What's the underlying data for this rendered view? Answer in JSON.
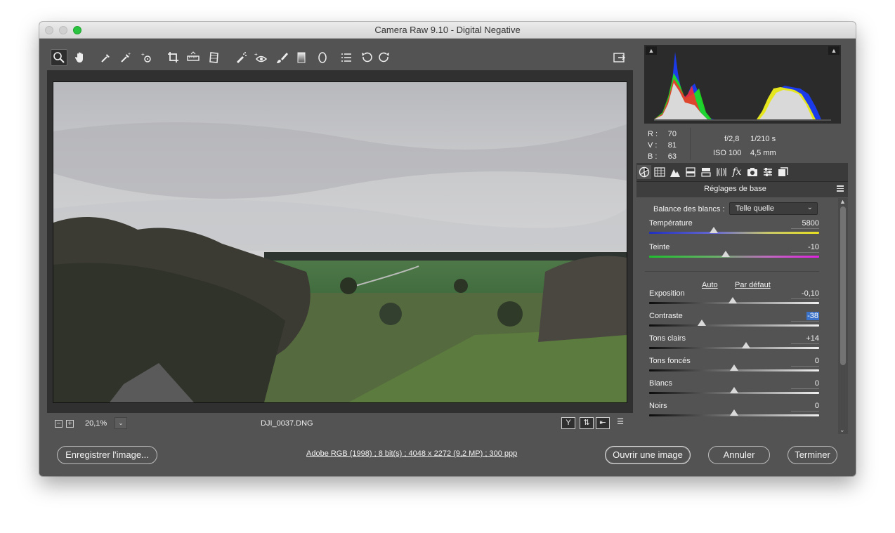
{
  "window": {
    "title": "Camera Raw 9.10  -  Digital Negative"
  },
  "toolbar": {
    "tools": [
      {
        "name": "zoom-tool-icon",
        "active": true
      },
      {
        "name": "hand-tool-icon"
      },
      {
        "name": "white-balance-tool-icon"
      },
      {
        "name": "color-sampler-tool-icon"
      },
      {
        "name": "targeted-adjustment-tool-icon"
      },
      {
        "name": "crop-tool-icon"
      },
      {
        "name": "straighten-tool-icon"
      },
      {
        "name": "transform-tool-icon"
      },
      {
        "name": "spot-removal-tool-icon"
      },
      {
        "name": "red-eye-removal-icon"
      },
      {
        "name": "adjustment-brush-icon"
      },
      {
        "name": "graduated-filter-icon"
      },
      {
        "name": "radial-filter-icon"
      },
      {
        "name": "preferences-icon"
      },
      {
        "name": "rotate-ccw-icon"
      },
      {
        "name": "rotate-cw-icon"
      }
    ]
  },
  "image": {
    "filename": "DJI_0037.DNG",
    "zoom": "20,1%"
  },
  "readout": {
    "r_label": "R :",
    "r": "70",
    "v_label": "V :",
    "v": "81",
    "b_label": "B :",
    "b": "63",
    "aperture": "f/2,8",
    "shutter": "1/210 s",
    "iso": "ISO 100",
    "focal": "4,5 mm"
  },
  "panel": {
    "title": "Réglages de base",
    "wb_label": "Balance des blancs :",
    "wb_value": "Telle quelle",
    "auto": "Auto",
    "default": "Par défaut",
    "sliders": [
      {
        "key": "temperature",
        "label": "Température",
        "value": "5800",
        "pos": 0.38,
        "track": "temp"
      },
      {
        "key": "tint",
        "label": "Teinte",
        "value": "-10",
        "pos": 0.45,
        "track": "tint"
      },
      {
        "key": "exposure",
        "label": "Exposition",
        "value": "-0,10",
        "pos": 0.49,
        "track": "gray"
      },
      {
        "key": "contrast",
        "label": "Contraste",
        "value": "-38",
        "pos": 0.31,
        "track": "gray",
        "selected": true
      },
      {
        "key": "highlights",
        "label": "Tons clairs",
        "value": "+14",
        "pos": 0.57,
        "track": "gray"
      },
      {
        "key": "shadows",
        "label": "Tons foncés",
        "value": "0",
        "pos": 0.5,
        "track": "gray"
      },
      {
        "key": "whites",
        "label": "Blancs",
        "value": "0",
        "pos": 0.5,
        "track": "gray"
      },
      {
        "key": "blacks",
        "label": "Noirs",
        "value": "0",
        "pos": 0.5,
        "track": "gray"
      }
    ]
  },
  "bottom": {
    "save": "Enregistrer l'image...",
    "workflow": "Adobe RGB (1998) ; 8 bit(s) ; 4048 x 2272 (9,2 MP) ; 300 ppp",
    "open": "Ouvrir une image",
    "cancel": "Annuler",
    "done": "Terminer"
  },
  "colors": {
    "panel_bg": "#535353",
    "dark_bg": "#303030",
    "selection": "#3a73c9"
  }
}
